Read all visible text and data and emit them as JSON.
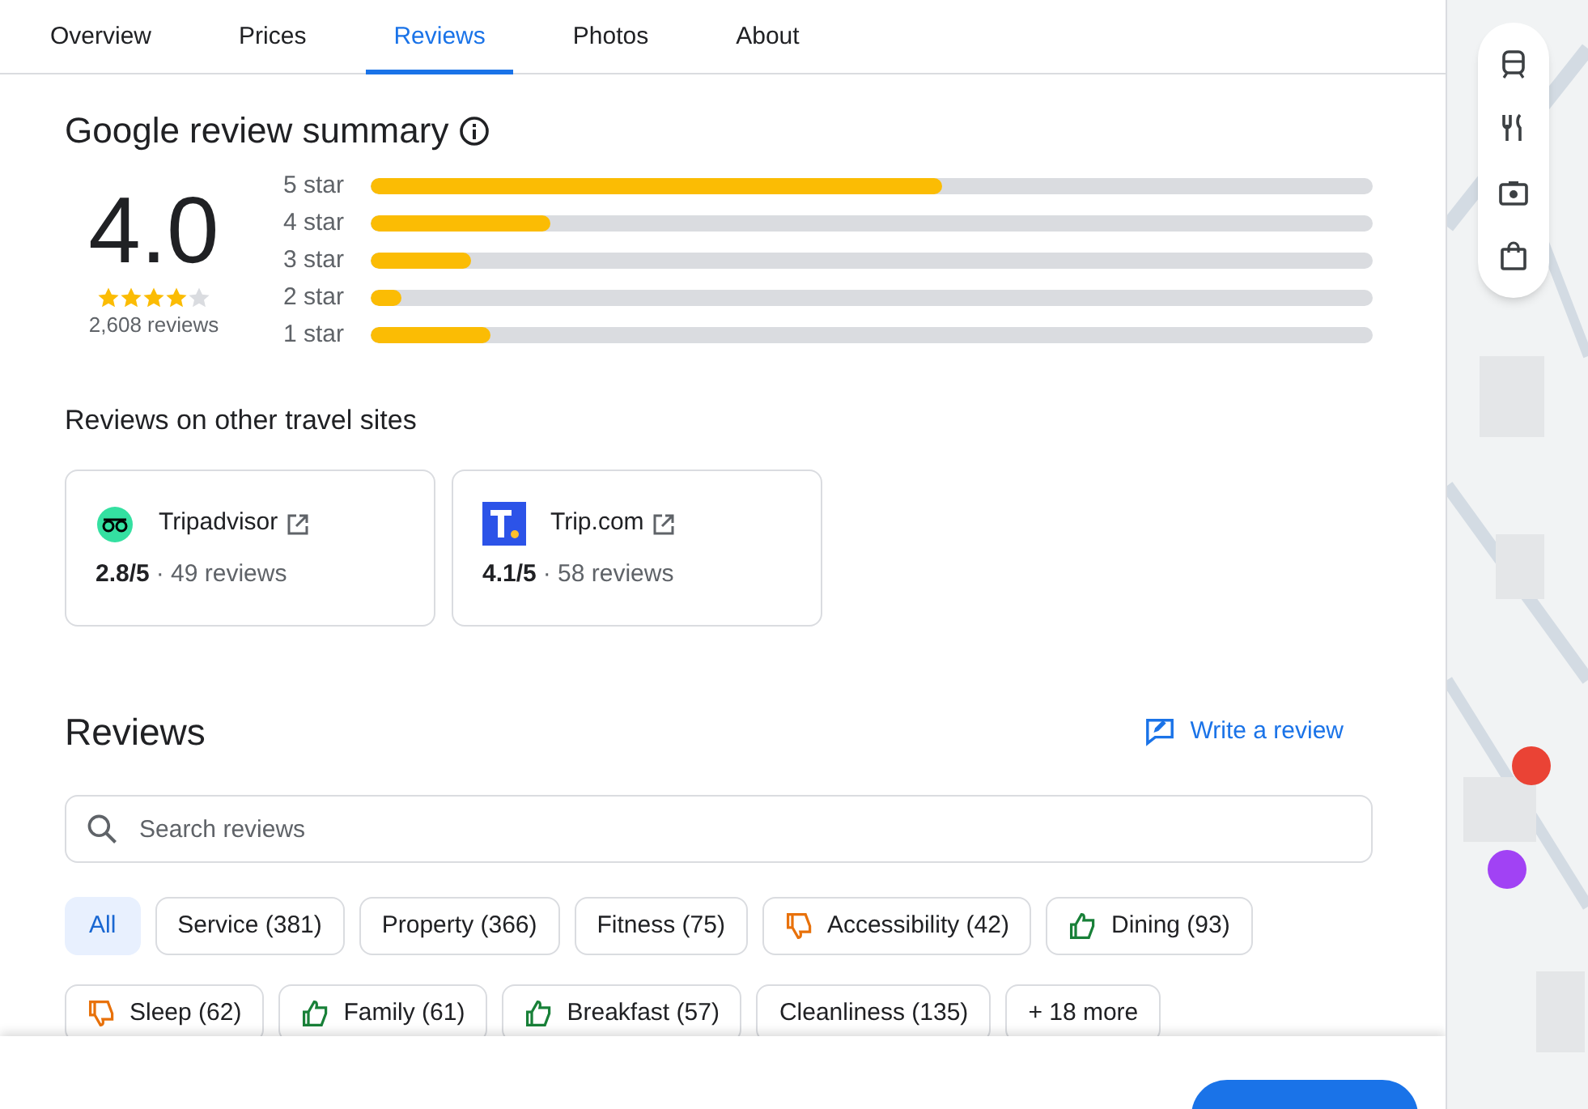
{
  "tabs": [
    {
      "label": "Overview",
      "selected": false
    },
    {
      "label": "Prices",
      "selected": false
    },
    {
      "label": "Reviews",
      "selected": true
    },
    {
      "label": "Photos",
      "selected": false
    },
    {
      "label": "About",
      "selected": false
    }
  ],
  "summary": {
    "title": "Google review summary",
    "rating": "4.0",
    "stars": 4,
    "count": "2,608 reviews",
    "bars": [
      {
        "label": "5 star",
        "level": 0.57
      },
      {
        "label": "4 star",
        "level": 0.18
      },
      {
        "label": "3 star",
        "level": 0.1
      },
      {
        "label": "2 star",
        "level": 0.03
      },
      {
        "label": "1 star",
        "level": 0.12
      }
    ]
  },
  "other_sites": {
    "title": "Reviews on other travel sites",
    "sites": [
      {
        "kind": "tripadvisor",
        "name": "Tripadvisor",
        "score": "2.8/5",
        "reviews": "· 49 reviews"
      },
      {
        "kind": "tripcom",
        "name": "Trip.com",
        "score": "4.1/5",
        "reviews": "· 58 reviews"
      }
    ]
  },
  "reviews": {
    "title": "Reviews",
    "write_link": "Write a review",
    "search": {
      "placeholder": "Search reviews"
    },
    "chips": [
      {
        "label": "All",
        "selected": true
      },
      {
        "label": "Service (381)",
        "selected": false
      },
      {
        "label": "Property (366)",
        "selected": false
      },
      {
        "label": "Fitness (75)",
        "selected": false
      },
      {
        "label": "Accessibility (42)",
        "selected": false,
        "kind": "negative"
      },
      {
        "label": "Dining (93)",
        "selected": false,
        "kind": "positive"
      },
      {
        "label": "Sleep (62)",
        "selected": false,
        "kind": "negative"
      },
      {
        "label": "Family (61)",
        "selected": false,
        "kind": "positive"
      },
      {
        "label": "Breakfast (57)",
        "selected": false,
        "kind": "positive"
      },
      {
        "label": "Cleanliness (135)",
        "selected": false
      },
      {
        "label": "+ 18 more",
        "selected": false
      }
    ]
  }
}
